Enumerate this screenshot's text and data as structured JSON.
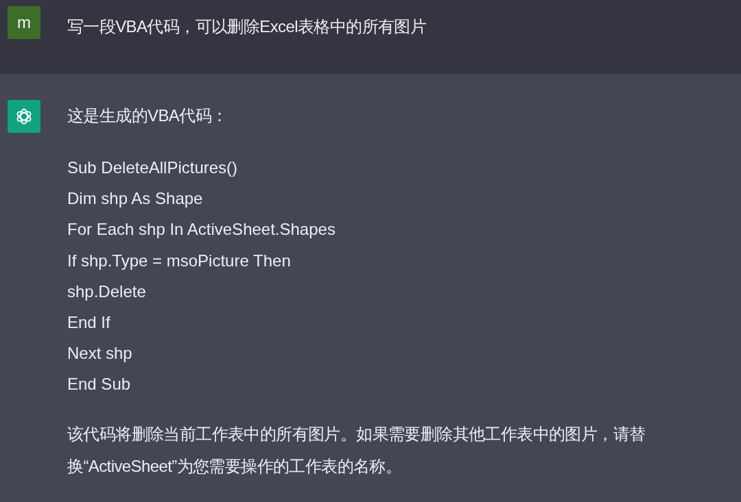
{
  "messages": [
    {
      "kind": "user",
      "avatar": "m",
      "blocks": [
        {
          "kind": "text",
          "text": "写一段VBA代码，可以删除Excel表格中的所有图片"
        }
      ]
    },
    {
      "kind": "assistant",
      "blocks": [
        {
          "kind": "text",
          "text": "这是生成的VBA代码："
        },
        {
          "kind": "code",
          "lines": [
            "Sub DeleteAllPictures()",
            "Dim shp As Shape",
            "For Each shp In ActiveSheet.Shapes",
            "If shp.Type = msoPicture Then",
            "shp.Delete",
            "End If",
            "Next shp",
            "End Sub"
          ]
        },
        {
          "kind": "text",
          "text": "该代码将删除当前工作表中的所有图片。如果需要删除其他工作表中的图片，请替换“ActiveSheet”为您需要操作的工作表的名称。"
        }
      ]
    }
  ]
}
